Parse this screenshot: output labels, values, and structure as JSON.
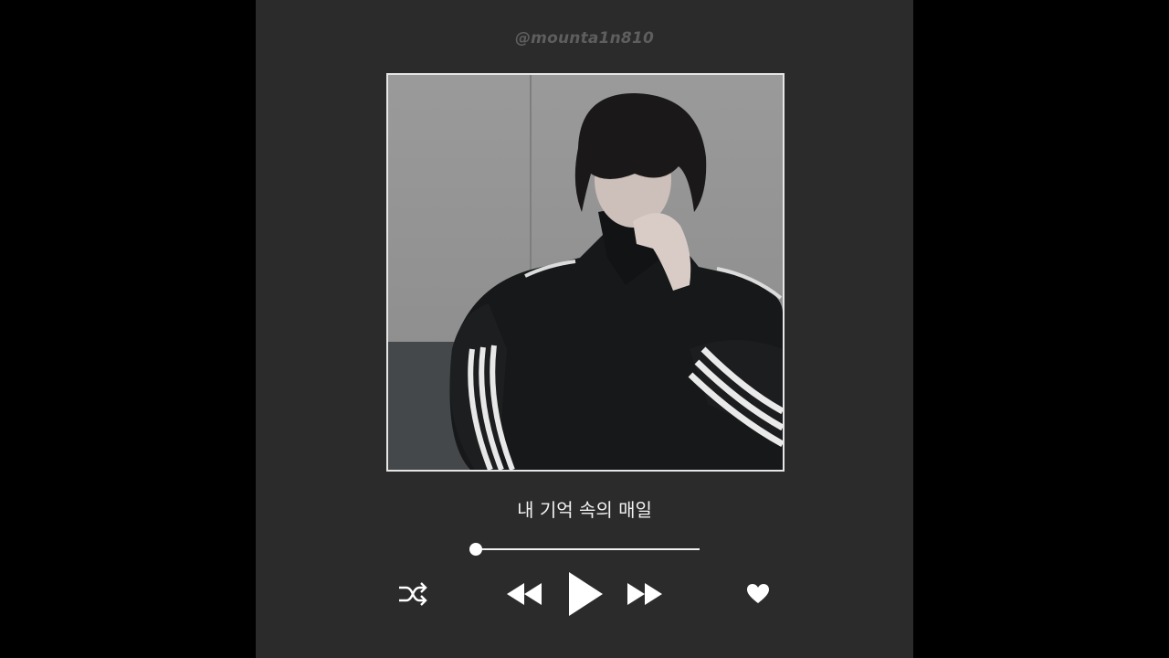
{
  "player": {
    "handle": "@mounta1n810",
    "track_title": "내 기억 속의 매일",
    "progress_fraction": 0.0
  },
  "controls": {
    "shuffle_icon": "shuffle-icon",
    "previous_icon": "rewind-icon",
    "play_icon": "play-icon",
    "next_icon": "fast-forward-icon",
    "like_icon": "heart-icon"
  },
  "colors": {
    "background": "#000000",
    "card": "#2b2b2b",
    "handle_text": "#5e5e5e",
    "foreground": "#ffffff"
  }
}
